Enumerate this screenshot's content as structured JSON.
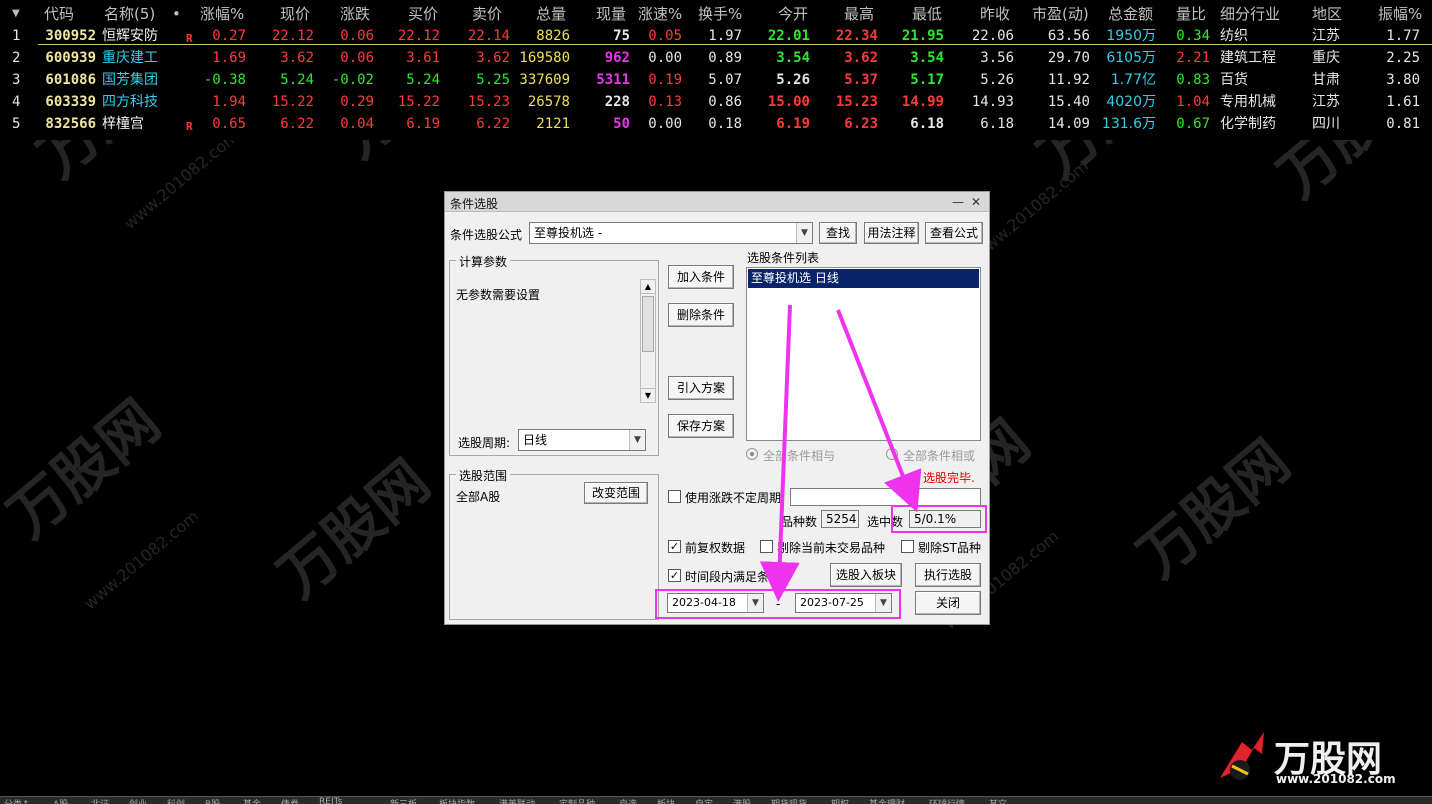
{
  "columns": [
    "代码",
    "名称(5)",
    "•",
    "涨幅%",
    "现价",
    "涨跌",
    "买价",
    "卖价",
    "总量",
    "现量",
    "涨速%",
    "换手%",
    "今开",
    "最高",
    "最低",
    "昨收",
    "市盈(动)",
    "总金额",
    "量比",
    "细分行业",
    "地区",
    "振幅%"
  ],
  "rows": [
    {
      "idx": "1",
      "code": "300952",
      "name": "恒辉安防",
      "flag": "R",
      "change_pct": "0.27",
      "price": "22.12",
      "change": "0.06",
      "bid": "22.12",
      "ask": "22.14",
      "volume": "8826",
      "cur_vol": "75",
      "speed": "0.05",
      "turnover": "1.97",
      "open": "22.01",
      "high": "22.34",
      "low": "21.95",
      "prev_close": "22.06",
      "pe": "63.56",
      "amount": "1950万",
      "vol_ratio": "0.34",
      "industry": "纺织",
      "region": "江苏",
      "amplitude": "1.77"
    },
    {
      "idx": "2",
      "code": "600939",
      "name": "重庆建工",
      "flag": "",
      "change_pct": "1.69",
      "price": "3.62",
      "change": "0.06",
      "bid": "3.61",
      "ask": "3.62",
      "volume": "169580",
      "cur_vol": "962",
      "speed": "0.00",
      "turnover": "0.89",
      "open": "3.54",
      "high": "3.62",
      "low": "3.54",
      "prev_close": "3.56",
      "pe": "29.70",
      "amount": "6105万",
      "vol_ratio": "2.21",
      "industry": "建筑工程",
      "region": "重庆",
      "amplitude": "2.25"
    },
    {
      "idx": "3",
      "code": "601086",
      "name": "国芳集团",
      "flag": "",
      "change_pct": "-0.38",
      "price": "5.24",
      "change": "-0.02",
      "bid": "5.24",
      "ask": "5.25",
      "volume": "337609",
      "cur_vol": "5311",
      "speed": "0.19",
      "turnover": "5.07",
      "open": "5.26",
      "high": "5.37",
      "low": "5.17",
      "prev_close": "5.26",
      "pe": "11.92",
      "amount": "1.77亿",
      "vol_ratio": "0.83",
      "industry": "百货",
      "region": "甘肃",
      "amplitude": "3.80"
    },
    {
      "idx": "4",
      "code": "603339",
      "name": "四方科技",
      "flag": "",
      "change_pct": "1.94",
      "price": "15.22",
      "change": "0.29",
      "bid": "15.22",
      "ask": "15.23",
      "volume": "26578",
      "cur_vol": "228",
      "speed": "0.13",
      "turnover": "0.86",
      "open": "15.00",
      "high": "15.23",
      "low": "14.99",
      "prev_close": "14.93",
      "pe": "15.40",
      "amount": "4020万",
      "vol_ratio": "1.04",
      "industry": "专用机械",
      "region": "江苏",
      "amplitude": "1.61"
    },
    {
      "idx": "5",
      "code": "832566",
      "name": "梓橦宫",
      "flag": "R",
      "change_pct": "0.65",
      "price": "6.22",
      "change": "0.04",
      "bid": "6.19",
      "ask": "6.22",
      "volume": "2121",
      "cur_vol": "50",
      "speed": "0.00",
      "turnover": "0.18",
      "open": "6.19",
      "high": "6.23",
      "low": "6.18",
      "prev_close": "6.18",
      "pe": "14.09",
      "amount": "131.6万",
      "vol_ratio": "0.67",
      "industry": "化学制药",
      "region": "四川",
      "amplitude": "0.81"
    }
  ],
  "colors": {
    "up": "#ff3a3a",
    "down": "#2ee82e",
    "flat": "#e6e6e6",
    "code": "#f0e6a0",
    "name_default": "#f2f2f2",
    "name_cyan": "#33ccee",
    "volume": "#f0e050",
    "cur_vol_magenta": "#ee33ee",
    "amount": "#33ccee",
    "dialog_accent": "#ee33ee",
    "status_red": "#e00000"
  },
  "dialog": {
    "title": "条件选股",
    "formula_label": "条件选股公式",
    "formula_value": "至尊投机选  -",
    "find_btn": "查找",
    "usage_btn": "用法注释",
    "view_btn": "查看公式",
    "calc_params_label": "计算参数",
    "no_params_text": "无参数需要设置",
    "period_label": "选股周期:",
    "period_value": "日线",
    "add_btn": "加入条件",
    "delete_btn": "删除条件",
    "import_btn": "引入方案",
    "save_btn": "保存方案",
    "cond_list_label": "选股条件列表",
    "cond_items": [
      "至尊投机选  日线"
    ],
    "radio_and": "全部条件相与",
    "radio_or": "全部条件相或",
    "status": "选股完毕.",
    "range_label": "选股范围",
    "range_value": "全部A股",
    "change_range_btn": "改变范围",
    "use_change_period": "使用涨跌不定周期",
    "count_label": "品种数",
    "count_value": "5254",
    "selected_label": "选中数",
    "selected_value": "5/0.1%",
    "chk_fq": "前复权数据",
    "chk_remove_nontrade": "剔除当前未交易品种",
    "chk_remove_st": "剔除ST品种",
    "chk_period": "时间段内满足条件",
    "to_block_btn": "选股入板块",
    "exec_btn": "执行选股",
    "date_from": "2023-04-18",
    "date_sep": "-",
    "date_to": "2023-07-25",
    "close_btn": "关闭"
  },
  "watermark": {
    "brand": "万股网",
    "url": "www.201082.com"
  },
  "tabs": [
    "分类↑",
    "A股",
    "北证",
    "创业",
    "科创",
    "B股",
    "基金",
    "债券",
    "REITs",
    "新三板",
    "板块指数",
    "港美联动",
    "定制品种",
    "自选",
    "板块",
    "自定",
    "港股",
    "期货现货",
    "期权",
    "基金理财",
    "环球行情",
    "其它"
  ]
}
